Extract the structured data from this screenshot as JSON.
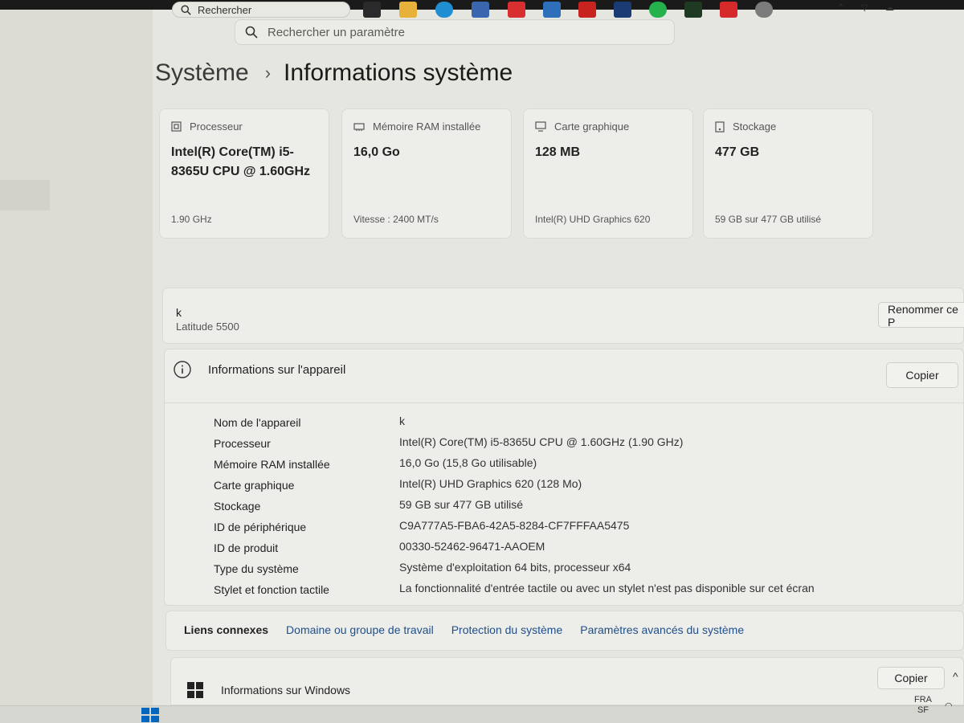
{
  "search": {
    "placeholder": "Rechercher un paramètre"
  },
  "breadcrumb": {
    "parent": "Système",
    "separator": "›",
    "current": "Informations système"
  },
  "cards": [
    {
      "label": "Processeur",
      "value": "Intel(R) Core(TM) i5-8365U CPU @ 1.60GHz",
      "sub": "1.90 GHz",
      "icon": "processor-icon"
    },
    {
      "label": "Mémoire RAM installée",
      "value": "16,0 Go",
      "sub": "Vitesse : 2400 MT/s",
      "icon": "memory-icon"
    },
    {
      "label": "Carte graphique",
      "value": "128 MB",
      "sub": "Intel(R) UHD Graphics 620",
      "icon": "display-icon"
    },
    {
      "label": "Stockage",
      "value": "477 GB",
      "sub": "59 GB sur 477 GB utilisé",
      "icon": "storage-icon"
    }
  ],
  "device": {
    "name": "k",
    "model": "Latitude 5500",
    "rename_label": "Renommer ce P"
  },
  "device_info": {
    "title": "Informations sur l'appareil",
    "copy_label": "Copier",
    "rows": [
      {
        "key": "Nom de l'appareil",
        "value": "k"
      },
      {
        "key": "Processeur",
        "value": "Intel(R) Core(TM) i5-8365U CPU @ 1.60GHz (1.90 GHz)"
      },
      {
        "key": "Mémoire RAM installée",
        "value": "16,0 Go (15,8 Go utilisable)"
      },
      {
        "key": "Carte graphique",
        "value": "Intel(R) UHD Graphics 620 (128 Mo)"
      },
      {
        "key": "Stockage",
        "value": "59 GB sur 477 GB utilisé"
      },
      {
        "key": "ID de périphérique",
        "value": "C9A777A5-FBA6-42A5-8284-CF7FFFAA5475"
      },
      {
        "key": "ID de produit",
        "value": "00330-52462-96471-AAOEM"
      },
      {
        "key": "Type du système",
        "value": "Système d'exploitation 64 bits, processeur x64"
      },
      {
        "key": "Stylet et fonction tactile",
        "value": "La fonctionnalité d'entrée tactile ou avec un stylet n'est pas disponible sur cet écran"
      }
    ]
  },
  "related_links": {
    "label": "Liens connexes",
    "items": [
      "Domaine ou groupe de travail",
      "Protection du système",
      "Paramètres avancés du système"
    ]
  },
  "windows_info": {
    "title": "Informations sur Windows",
    "copy_label": "Copier"
  },
  "taskbar": {
    "search_label": "Rechercher",
    "lang_line1": "FRA",
    "lang_line2": "SF",
    "colors": {
      "accent": "#0067c0",
      "link": "#1e4f8a"
    }
  }
}
